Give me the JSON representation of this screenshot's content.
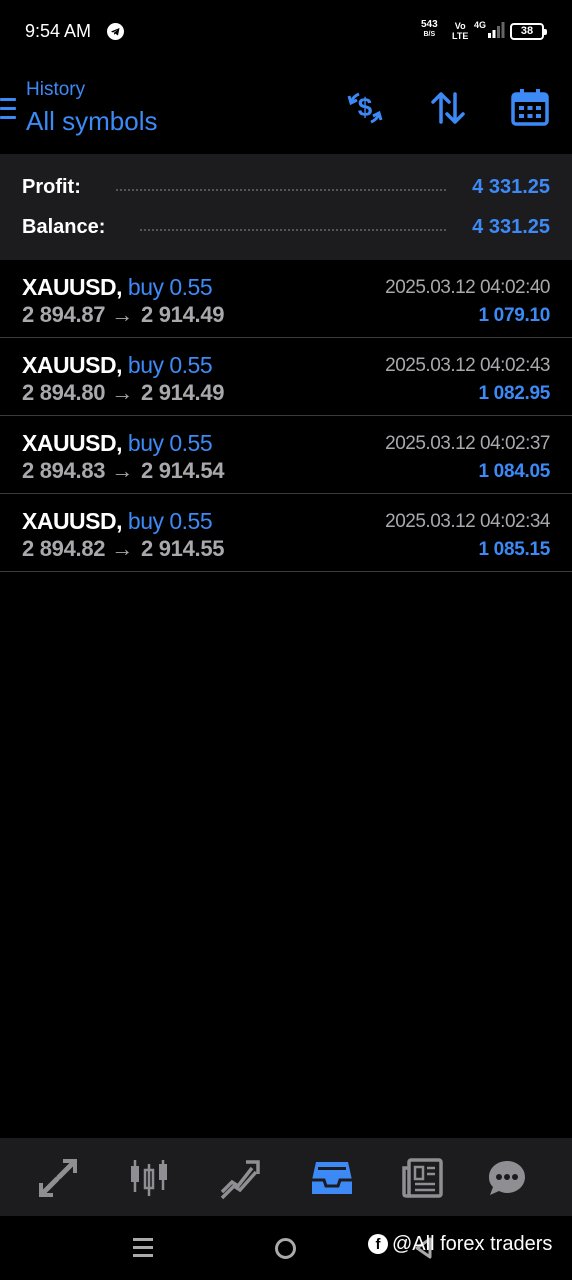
{
  "status_bar": {
    "time": "9:54 AM",
    "net_speed": "543",
    "net_speed_unit": "B/S",
    "volte_top": "Vo",
    "volte_bottom": "LTE",
    "network": "4G",
    "battery": "38"
  },
  "header": {
    "subtitle": "History",
    "title": "All symbols",
    "icons": [
      "menu-icon",
      "dollar-refresh-icon",
      "sort-icon",
      "calendar-icon"
    ]
  },
  "summary": {
    "profit_label": "Profit:",
    "profit_value": "4 331.25",
    "balance_label": "Balance:",
    "balance_value": "4 331.25"
  },
  "trades": [
    {
      "symbol": "XAUUSD,",
      "side": "buy 0.55",
      "open": "2 894.87",
      "close": "2 914.49",
      "time": "2025.03.12 04:02:40",
      "profit": "1 079.10"
    },
    {
      "symbol": "XAUUSD,",
      "side": "buy 0.55",
      "open": "2 894.80",
      "close": "2 914.49",
      "time": "2025.03.12 04:02:43",
      "profit": "1 082.95"
    },
    {
      "symbol": "XAUUSD,",
      "side": "buy 0.55",
      "open": "2 894.83",
      "close": "2 914.54",
      "time": "2025.03.12 04:02:37",
      "profit": "1 084.05"
    },
    {
      "symbol": "XAUUSD,",
      "side": "buy 0.55",
      "open": "2 894.82",
      "close": "2 914.55",
      "time": "2025.03.12 04:02:34",
      "profit": "1 085.15"
    }
  ],
  "bottom_nav": {
    "items": [
      "quotes-icon",
      "chart-icon",
      "trade-icon",
      "history-icon",
      "news-icon",
      "messages-icon"
    ],
    "active": "history-icon"
  },
  "watermark": {
    "text": "@All forex traders",
    "icon": "facebook-icon"
  },
  "colors": {
    "accent": "#3d8af7",
    "background": "#000000",
    "panel": "#1c1c1e",
    "muted_text": "#a9a9ad"
  }
}
